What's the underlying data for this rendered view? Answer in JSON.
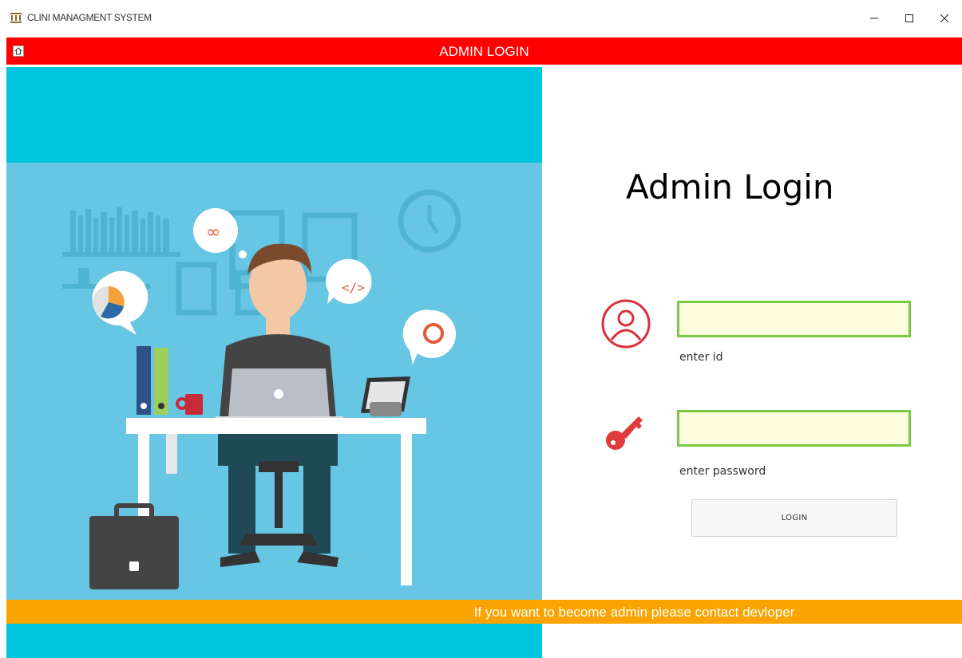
{
  "window": {
    "title": "CLINI MANAGMENT SYSTEM",
    "minimize_symbol": "–",
    "maximize_symbol": "☐",
    "close_symbol": "✕"
  },
  "header": {
    "title": "ADMIN LOGIN",
    "home_icon": "home-icon"
  },
  "login": {
    "heading": "Admin Login",
    "id_value": "",
    "id_label": "enter id",
    "password_value": "",
    "password_label": "enter password",
    "button_label": "LOGIN",
    "user_icon": "user-circle-icon",
    "key_icon": "key-icon"
  },
  "footer": {
    "message": "If you want to become admin please contact devloper"
  },
  "colors": {
    "header_bg": "#ff0000",
    "footer_bg": "#f9a400",
    "illustration_top": "#00c5df",
    "illustration_bg": "#67c6e3",
    "field_border": "#7ac943",
    "field_bg": "#fffde0",
    "icon_red": "#d9303a"
  }
}
